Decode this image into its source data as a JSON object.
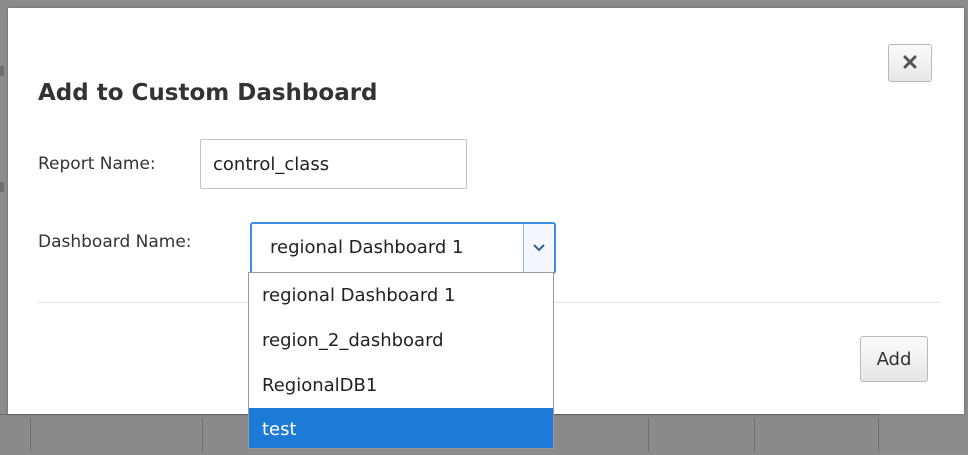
{
  "dialog": {
    "title": "Add to Custom Dashboard",
    "close_icon": "close-icon",
    "report_name": {
      "label": "Report Name:",
      "value": "control_class"
    },
    "dashboard_name": {
      "label": "Dashboard Name:",
      "selected": "regional Dashboard 1",
      "arrow_icon": "chevron-down-icon",
      "options": [
        "regional Dashboard 1",
        "region_2_dashboard",
        "RegionalDB1",
        "test"
      ],
      "highlighted_option": "test"
    },
    "add_label": "Add"
  },
  "colors": {
    "accent": "#1e7ad7",
    "focus_border": "#3a8ee6",
    "backdrop": "#8c8c8c"
  }
}
